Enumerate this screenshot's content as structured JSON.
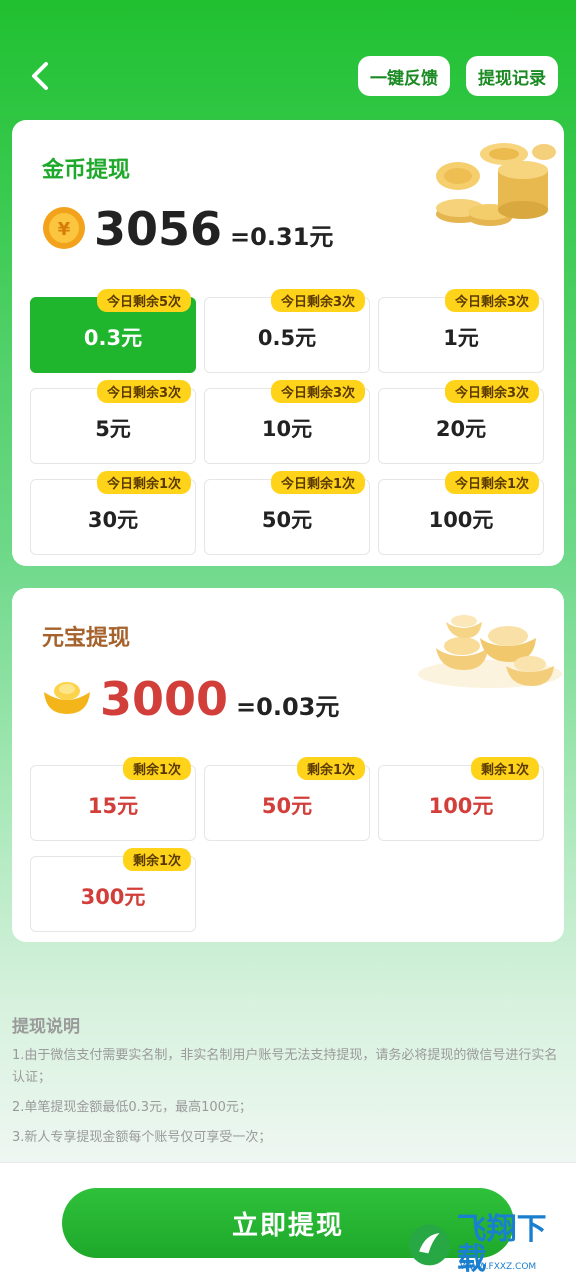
{
  "header": {
    "feedback_label": "一键反馈",
    "records_label": "提现记录"
  },
  "coin_section": {
    "title": "金币提现",
    "balance": "3056",
    "equivalent": "=0.31元",
    "options": [
      {
        "value": "0.3元",
        "badge": "今日剩余5次",
        "selected": true
      },
      {
        "value": "0.5元",
        "badge": "今日剩余3次"
      },
      {
        "value": "1元",
        "badge": "今日剩余3次"
      },
      {
        "value": "5元",
        "badge": "今日剩余3次"
      },
      {
        "value": "10元",
        "badge": "今日剩余3次"
      },
      {
        "value": "20元",
        "badge": "今日剩余3次"
      },
      {
        "value": "30元",
        "badge": "今日剩余1次"
      },
      {
        "value": "50元",
        "badge": "今日剩余1次"
      },
      {
        "value": "100元",
        "badge": "今日剩余1次"
      }
    ]
  },
  "ingot_section": {
    "title": "元宝提现",
    "balance": "3000",
    "equivalent": "=0.03元",
    "options": [
      {
        "value": "15元",
        "badge": "剩余1次"
      },
      {
        "value": "50元",
        "badge": "剩余1次"
      },
      {
        "value": "100元",
        "badge": "剩余1次"
      },
      {
        "value": "300元",
        "badge": "剩余1次"
      }
    ]
  },
  "notes": {
    "title": "提现说明",
    "items": [
      "1.由于微信支付需要实名制，非实名制用户账号无法支持提现，请务必将提现的微信号进行实名认证；",
      "2.单笔提现金额最低0.3元，最高100元；",
      "3.新人专享提现金额每个账号仅可享受一次；"
    ]
  },
  "cta_label": "立即提现",
  "watermark": {
    "text": "飞翔下载",
    "url": "WWW.FXXZ.COM"
  },
  "colors": {
    "brand_green": "#1fb52c",
    "badge_yellow": "#ffd31a",
    "ingot_red": "#d23f3a"
  }
}
